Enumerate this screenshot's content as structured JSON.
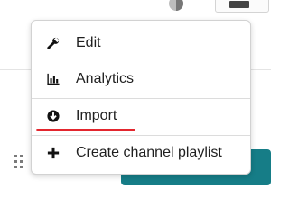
{
  "menu": {
    "items": [
      {
        "label": "Edit",
        "icon": "wrench-icon"
      },
      {
        "label": "Analytics",
        "icon": "bar-chart-icon"
      },
      {
        "label": "Import",
        "icon": "download-circle-icon"
      },
      {
        "label": "Create channel playlist",
        "icon": "plus-icon"
      }
    ]
  },
  "colors": {
    "highlight_underline": "#e3262e",
    "teal_button": "#167d87",
    "text": "#1f1f1f"
  }
}
